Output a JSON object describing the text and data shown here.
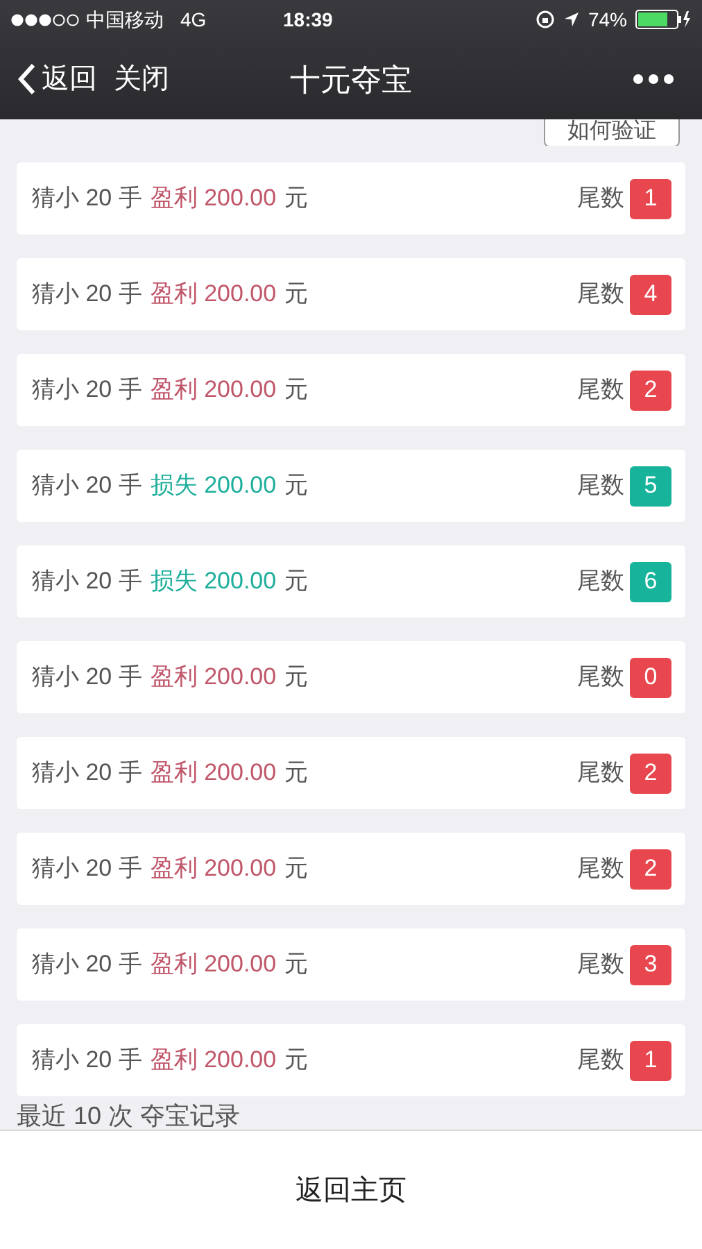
{
  "status_bar": {
    "carrier": "中国移动",
    "network": "4G",
    "time": "18:39",
    "battery": "74%"
  },
  "nav": {
    "back": "返回",
    "close": "关闭",
    "title": "十元夺宝"
  },
  "verify_button": {
    "label": "如何验证"
  },
  "records": [
    {
      "bet": "猜小 20 手",
      "kind": "profit",
      "result": "盈利 200.00",
      "unit": "元",
      "tail_label": "尾数",
      "tail": "1"
    },
    {
      "bet": "猜小 20 手",
      "kind": "profit",
      "result": "盈利 200.00",
      "unit": "元",
      "tail_label": "尾数",
      "tail": "4"
    },
    {
      "bet": "猜小 20 手",
      "kind": "profit",
      "result": "盈利 200.00",
      "unit": "元",
      "tail_label": "尾数",
      "tail": "2"
    },
    {
      "bet": "猜小 20 手",
      "kind": "loss",
      "result": "损失 200.00",
      "unit": "元",
      "tail_label": "尾数",
      "tail": "5"
    },
    {
      "bet": "猜小 20 手",
      "kind": "loss",
      "result": "损失 200.00",
      "unit": "元",
      "tail_label": "尾数",
      "tail": "6"
    },
    {
      "bet": "猜小 20 手",
      "kind": "profit",
      "result": "盈利 200.00",
      "unit": "元",
      "tail_label": "尾数",
      "tail": "0"
    },
    {
      "bet": "猜小 20 手",
      "kind": "profit",
      "result": "盈利 200.00",
      "unit": "元",
      "tail_label": "尾数",
      "tail": "2"
    },
    {
      "bet": "猜小 20 手",
      "kind": "profit",
      "result": "盈利 200.00",
      "unit": "元",
      "tail_label": "尾数",
      "tail": "2"
    },
    {
      "bet": "猜小 20 手",
      "kind": "profit",
      "result": "盈利 200.00",
      "unit": "元",
      "tail_label": "尾数",
      "tail": "3"
    },
    {
      "bet": "猜小 20 手",
      "kind": "profit",
      "result": "盈利 200.00",
      "unit": "元",
      "tail_label": "尾数",
      "tail": "1"
    }
  ],
  "section_caption": "最近 10 次 夺宝记录",
  "bottom_button": {
    "label": "返回主页"
  }
}
